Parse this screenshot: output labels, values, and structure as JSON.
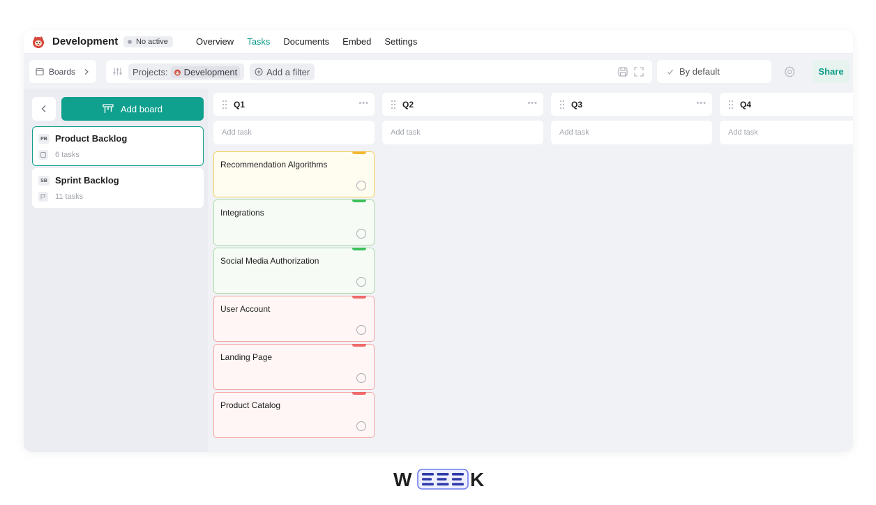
{
  "project": {
    "title": "Development",
    "status": "No active"
  },
  "nav": {
    "items": [
      {
        "label": "Overview",
        "active": false
      },
      {
        "label": "Tasks",
        "active": true
      },
      {
        "label": "Documents",
        "active": false
      },
      {
        "label": "Embed",
        "active": false
      },
      {
        "label": "Settings",
        "active": false
      }
    ]
  },
  "toolbar": {
    "boards_label": "Boards",
    "projects_label": "Projects:",
    "project_chip": "Development",
    "add_filter": "Add a filter",
    "sort_label": "By default",
    "share_label": "Share"
  },
  "sidebar": {
    "add_board": "Add board",
    "boards": [
      {
        "badge": "PB",
        "name": "Product Backlog",
        "count": "6 tasks",
        "selected": true
      },
      {
        "badge": "SB",
        "name": "Sprint Backlog",
        "count": "11 tasks",
        "selected": false
      }
    ]
  },
  "columns": [
    {
      "title": "Q1",
      "add_task": "Add task"
    },
    {
      "title": "Q2",
      "add_task": "Add task"
    },
    {
      "title": "Q3",
      "add_task": "Add task"
    },
    {
      "title": "Q4",
      "add_task": "Add task"
    }
  ],
  "tasks": [
    {
      "title": "Recommendation Algorithms",
      "priority": "medium"
    },
    {
      "title": "Integrations",
      "priority": "low"
    },
    {
      "title": "Social Media Authorization",
      "priority": "low"
    },
    {
      "title": "User Account",
      "priority": "high"
    },
    {
      "title": "Landing Page",
      "priority": "high"
    },
    {
      "title": "Product Catalog",
      "priority": "high"
    }
  ],
  "colors": {
    "accent": "#10a08e",
    "priority_medium": "#f2b731",
    "priority_low": "#3cc05a",
    "priority_high": "#f06a6a"
  },
  "brand": {
    "logo": "WEEEK"
  }
}
